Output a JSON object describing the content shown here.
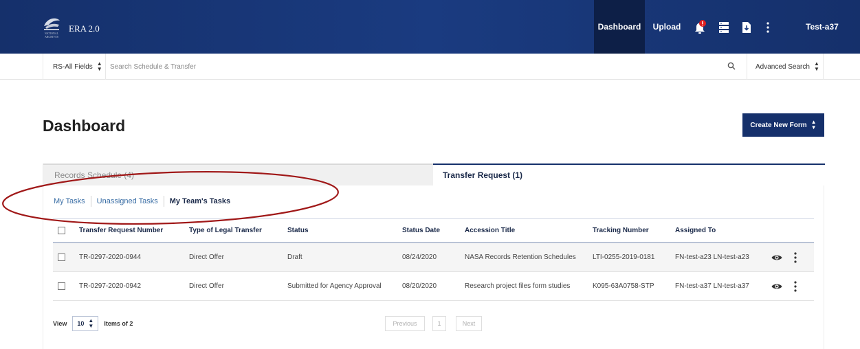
{
  "header": {
    "logo_text": "NATIONAL ARCHIVES",
    "app_name": "ERA 2.0",
    "nav": {
      "dashboard": "Dashboard",
      "upload": "Upload"
    },
    "icons": [
      "notification-bell-icon",
      "list-view-icon",
      "download-file-icon",
      "more-vertical-icon"
    ],
    "user": "Test-a37",
    "colors": {
      "bar": "#1a3b80",
      "active": "#0d1f47",
      "alert": "#e02020"
    }
  },
  "search": {
    "field": "RS-All Fields",
    "placeholder": "Search Schedule & Transfer",
    "advanced": "Advanced Search"
  },
  "page": {
    "title": "Dashboard",
    "create_button": "Create New Form"
  },
  "tabs": {
    "records_schedule": "Records Schedule (4)",
    "transfer_request": "Transfer Request (1)"
  },
  "subtabs": {
    "my_tasks": "My Tasks",
    "unassigned_tasks": "Unassigned Tasks",
    "team_tasks": "My Team's Tasks"
  },
  "table": {
    "headers": {
      "number": "Transfer Request Number",
      "type": "Type of Legal Transfer",
      "status": "Status",
      "status_date": "Status Date",
      "accession": "Accession Title",
      "tracking": "Tracking Number",
      "assigned": "Assigned To"
    },
    "rows": [
      {
        "number": "TR-0297-2020-0944",
        "type": "Direct Offer",
        "status": "Draft",
        "status_date": "08/24/2020",
        "accession": "NASA Records Retention Schedules",
        "tracking": "LTI-0255-2019-0181",
        "assigned": "FN-test-a23 LN-test-a23"
      },
      {
        "number": "TR-0297-2020-0942",
        "type": "Direct Offer",
        "status": "Submitted for Agency Approval",
        "status_date": "08/20/2020",
        "accession": "Research project files form studies",
        "tracking": "K095-63A0758-STP",
        "assigned": "FN-test-a37 LN-test-a37"
      }
    ]
  },
  "pagination": {
    "view_label": "View",
    "per_page": "10",
    "items_label": "Items of 2",
    "previous": "Previous",
    "page": "1",
    "next": "Next"
  },
  "annotation": {
    "shape": "ellipse",
    "color": "#a01818"
  }
}
